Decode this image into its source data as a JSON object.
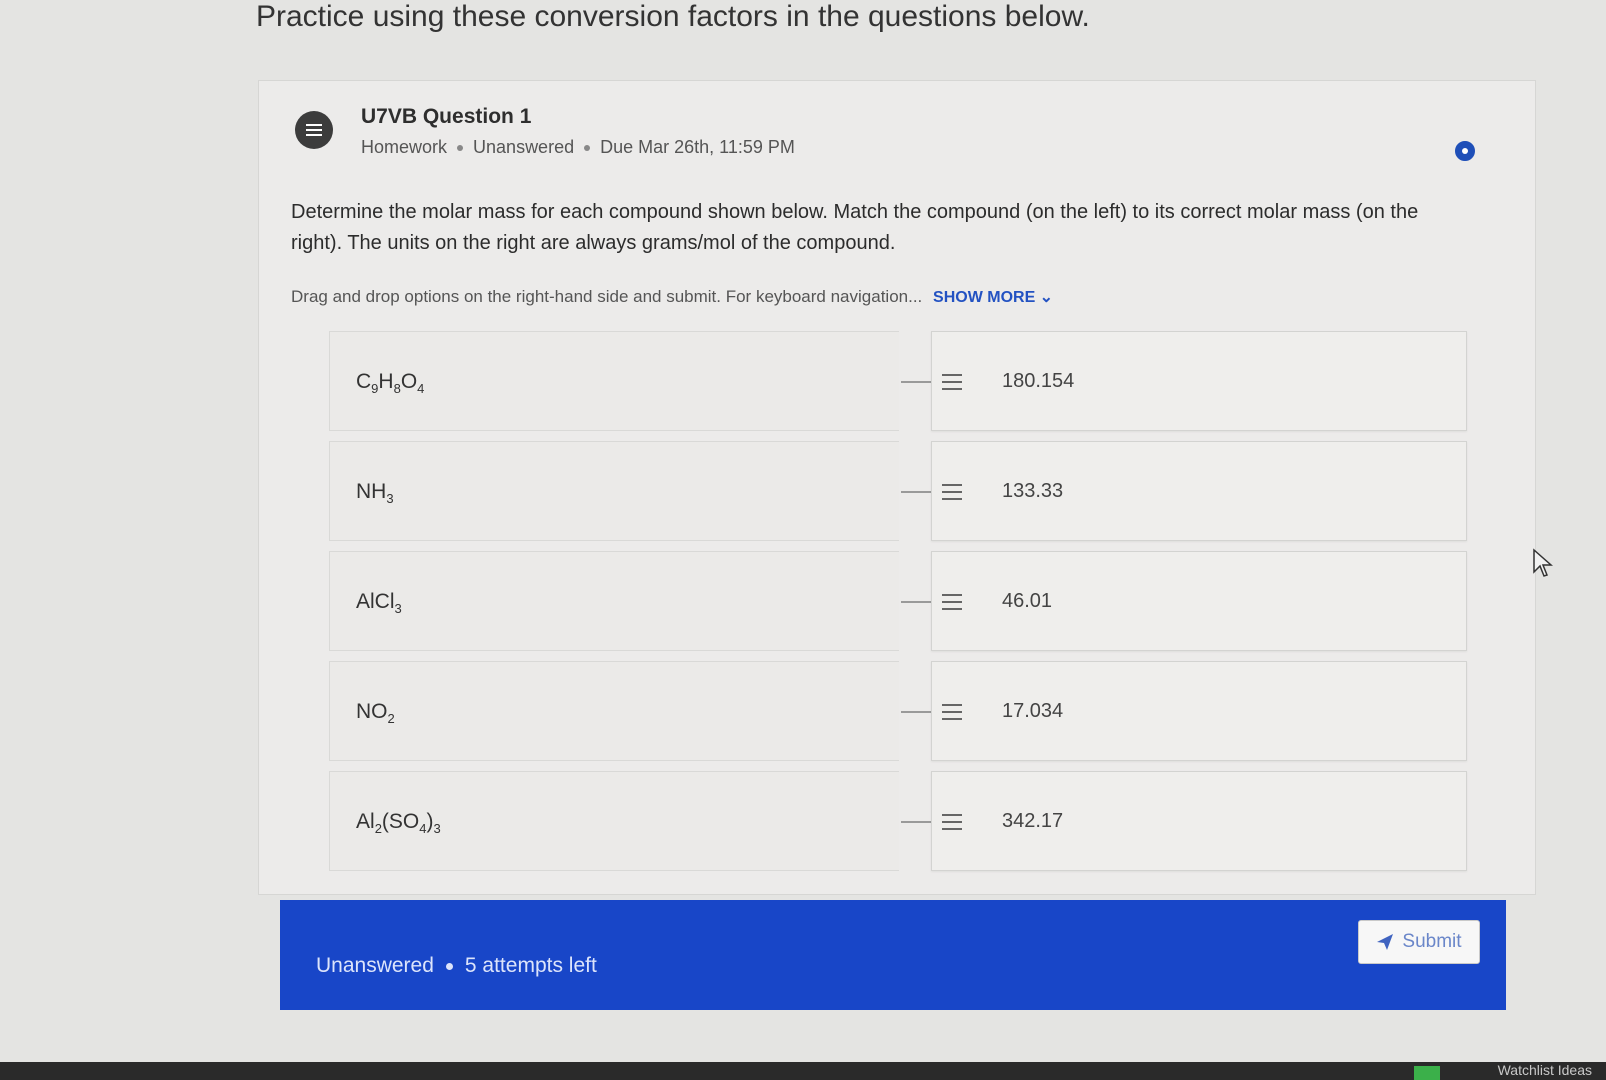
{
  "header": {
    "intro": "Practice using these conversion factors in the questions below."
  },
  "question": {
    "title": "U7VB Question 1",
    "meta": {
      "type": "Homework",
      "status": "Unanswered",
      "due": "Due Mar 26th, 11:59 PM"
    },
    "prompt": "Determine the molar mass for each compound shown below. Match the compound (on the left) to its correct molar mass (on the right). The units on the right are always grams/mol of the compound.",
    "instructions": "Drag and drop options on the right-hand side and submit. For keyboard navigation...",
    "show_more": "SHOW MORE",
    "pairs": [
      {
        "compound": [
          "C",
          "9",
          "H",
          "8",
          "O",
          "4"
        ],
        "mass": "180.154"
      },
      {
        "compound": [
          "NH",
          "3"
        ],
        "mass": "133.33"
      },
      {
        "compound": [
          "AlCl",
          "3"
        ],
        "mass": "46.01"
      },
      {
        "compound": [
          "NO",
          "2"
        ],
        "mass": "17.034"
      },
      {
        "compound": [
          "Al",
          "2",
          "(SO",
          "4",
          ")",
          "3"
        ],
        "mass": "342.17"
      }
    ]
  },
  "footer": {
    "status": "Unanswered",
    "attempts": "5 attempts left",
    "submit_label": "Submit"
  },
  "taskbar": {
    "text": "Watchlist Ideas"
  },
  "colors": {
    "footer_bg": "#1846c8",
    "accent": "#2352c2"
  }
}
